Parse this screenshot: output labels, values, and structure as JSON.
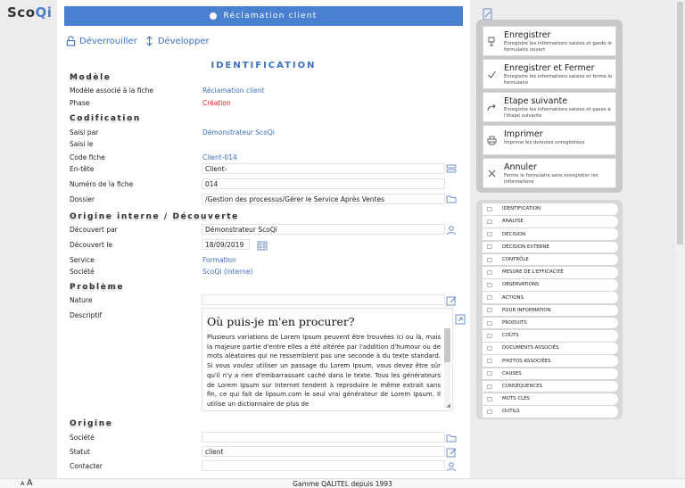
{
  "app": {
    "logo_a": "Sco",
    "logo_b": "Qi"
  },
  "titlebar": {
    "title": "Réclamation client"
  },
  "toolbar": {
    "unlock": "Déverrouiller",
    "expand": "Développer"
  },
  "sections": {
    "identification": "IDENTIFICATION",
    "modele": "Modèle",
    "codification": "Codification",
    "origine_interne": "Origine interne / Découverte",
    "probleme": "Problème",
    "origine": "Origine"
  },
  "fields": {
    "modele_associe": {
      "label": "Modèle associé à la fiche",
      "value": "Réclamation client"
    },
    "phase": {
      "label": "Phase",
      "value": "Création"
    },
    "saisi_par": {
      "label": "Saisi par",
      "value": "Démonstrateur ScoQi"
    },
    "saisi_le": {
      "label": "Saisi le",
      "value": ""
    },
    "code_fiche": {
      "label": "Code fiche",
      "value": "Client-014"
    },
    "en_tete": {
      "label": "En-tête",
      "value": "Client-"
    },
    "numero_fiche": {
      "label": "Numéro de la fiche",
      "value": "014"
    },
    "dossier": {
      "label": "Dossier",
      "value": "/Gestion des processus/Gérer le Service Après Ventes"
    },
    "decouvert_par": {
      "label": "Découvert par",
      "value": "Démonstrateur ScoQi"
    },
    "decouvert_le": {
      "label": "Découvert le",
      "value": "18/09/2019"
    },
    "service": {
      "label": "Service",
      "value": "Formation"
    },
    "societe_interne": {
      "label": "Société",
      "value": "ScoQi (interne)"
    },
    "nature": {
      "label": "Nature",
      "value": ""
    },
    "descriptif": {
      "label": "Descriptif"
    },
    "societe_origine": {
      "label": "Société",
      "value": ""
    },
    "statut": {
      "label": "Statut",
      "value": "client"
    },
    "contacter": {
      "label": "Contacter",
      "value": ""
    }
  },
  "editor": {
    "heading": "Où puis-je m'en procurer?",
    "body": "Plusieurs variations de Lorem Ipsum peuvent être trouvées ici ou là, mais la majeure partie d'entre elles a été altérée par l'addition d'humour ou de mots aléatoires qui ne ressemblent pas une seconde à du texte standard. Si vous voulez utiliser un passage du Lorem Ipsum, vous devez être sûr qu'il n'y a rien d'embarrassant caché dans le texte. Tous les générateurs de Lorem Ipsum sur Internet tendent à reproduire le même extrait sans fin, ce qui fait de lipsum.com le seul vrai générateur de Lorem Ipsum. Il utilise un dictionnaire de plus de"
  },
  "actions": [
    {
      "title": "Enregistrer",
      "desc": "Enregistre les informations saisies et garde le formulaire ouvert"
    },
    {
      "title": "Enregistrer et Fermer",
      "desc": "Enregistre les informations saisies et ferme le formulaire"
    },
    {
      "title": "Etape suivante",
      "desc": "Enregistre les informations saisies et passe à l'étape suivante"
    },
    {
      "title": "Imprimer",
      "desc": "Imprime les données enregistrées"
    },
    {
      "title": "Annuler",
      "desc": "Ferme le formulaire sans enregistrer les informations"
    }
  ],
  "nav": [
    "IDENTIFICATION",
    "ANALYSE",
    "DÉCISION",
    "DÉCISION EXTERNE",
    "CONTRÔLE",
    "MESURE DE L'EFFICACITÉ",
    "OBSERVATIONS",
    "ACTIONS",
    "POUR INFORMATION",
    "PRODUITS",
    "COÛTS",
    "DOCUMENTS ASSOCIÉS",
    "PHOTOS ASSOCIÉES",
    "CAUSES",
    "CONSÉQUENCES",
    "MOTS CLÉS",
    "OUTILS"
  ],
  "footer": {
    "text": "Gamme QALITEL depuis 1993",
    "font_small": "A",
    "font_large": "A"
  },
  "colors": {
    "accent": "#4a80d0",
    "link": "#3b6fc0",
    "phase": "#e02020"
  }
}
